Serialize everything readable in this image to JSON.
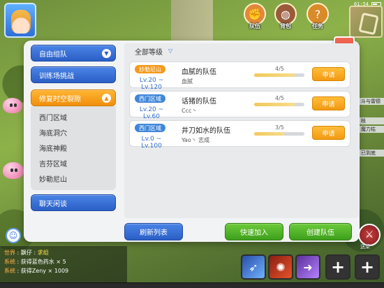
{
  "status": {
    "time": "01:54"
  },
  "top_icons": [
    {
      "label": "队伍",
      "icon": "fist-icon",
      "color": "#e2883a"
    },
    {
      "label": "背包",
      "icon": "bag-icon",
      "color": "#9a5b3a"
    },
    {
      "label": "任务",
      "icon": "scroll-icon",
      "color": "#d98a2a"
    }
  ],
  "team_panel": {
    "left_menu": {
      "free_team": "自由组队",
      "arena": "训练场挑战",
      "rift": "修复时空裂隙",
      "regions": [
        "西门区域",
        "海底洞穴",
        "海底神殿",
        "吉芬区域",
        "妙勒尼山"
      ],
      "chat": "聊天闲谈"
    },
    "level_filter": "全部等级",
    "teams": [
      {
        "zone": "妙勒尼山",
        "zone_color": "orange",
        "level_range": "Lv.20 ~ Lv.120",
        "name": "血腻的队伍",
        "members": "血腻",
        "count": "4/5",
        "fill": 0.8,
        "apply": "申请"
      },
      {
        "zone": "西门区域",
        "zone_color": "blue",
        "level_range": "Lv.20 ~ Lv.60",
        "name": "话猪的队伍",
        "members": "Ccc丶",
        "count": "4/5",
        "fill": 0.8,
        "apply": "申请"
      },
      {
        "zone": "西门区域",
        "zone_color": "blue",
        "level_range": "Lv.0 ~ Lv.100",
        "name": "井刀如水的队伍",
        "members": "Yao丶 志成",
        "count": "3/5",
        "fill": 0.6,
        "apply": "申请"
      }
    ],
    "buttons": {
      "refresh": "刷新列表",
      "quick_join": "快速加入",
      "create": "创建队伍"
    }
  },
  "chat": {
    "lines": [
      {
        "channel": "世界",
        "user": "飘仔",
        "text": "求组"
      },
      {
        "channel": "系统",
        "text": "获得蓝色药水 × 5"
      },
      {
        "channel": "系统",
        "text": "获得Zeny × 1009"
      }
    ]
  },
  "side_snippets": [
    "斗与雷德",
    "枝",
    "魔力枯",
    "已到底"
  ],
  "quest_badge": "送菜"
}
